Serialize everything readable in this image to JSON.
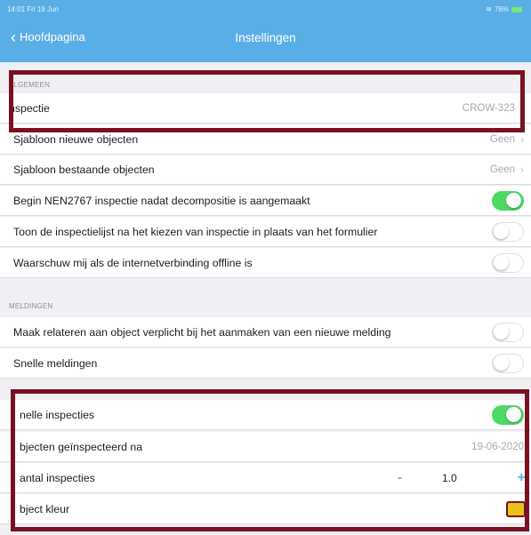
{
  "status": {
    "time": "14:01",
    "date": "Fri 19 Jun",
    "battery": "76%"
  },
  "nav": {
    "back_label": "Hoofdpagina",
    "title": "Instellingen"
  },
  "sections": {
    "algemeen": {
      "header": "ALGEMEEN"
    },
    "meldingen": {
      "header": "MELDINGEN"
    }
  },
  "rows": {
    "inspectie": {
      "label": "nspectie",
      "value": "CROW-323"
    },
    "sjabloon_nieuw": {
      "label": "Sjabloon nieuwe objecten",
      "value": "Geen"
    },
    "sjabloon_bestaand": {
      "label": "Sjabloon bestaande objecten",
      "value": "Geen"
    },
    "begin_nen": {
      "label": "Begin NEN2767 inspectie nadat decompositie is aangemaakt",
      "on": true
    },
    "toon_lijst": {
      "label": "Toon de inspectielijst na het kiezen van inspectie in plaats van het formulier",
      "on": false
    },
    "waarschuw": {
      "label": "Waarschuw mij als de internetverbinding offline is",
      "on": false
    },
    "maak_relateren": {
      "label": "Maak relateren aan object verplicht bij het aanmaken van een nieuwe melding",
      "on": false
    },
    "snelle_meldingen": {
      "label": "Snelle meldingen",
      "on": false
    },
    "snelle_inspecties": {
      "label": "nelle inspecties",
      "on": true
    },
    "objecten_na": {
      "label": "bjecten geïnspecteerd na",
      "value": "19-06-2020"
    },
    "aantal": {
      "label": "antal inspecties",
      "minus": "-",
      "value": "1.0",
      "plus": "+"
    },
    "object_kleur": {
      "label": "bject kleur",
      "color": "#e8c21a"
    }
  },
  "colors": {
    "accent": "#5aaee6",
    "toggle_on": "#4cd964",
    "highlight": "#7a1020"
  }
}
